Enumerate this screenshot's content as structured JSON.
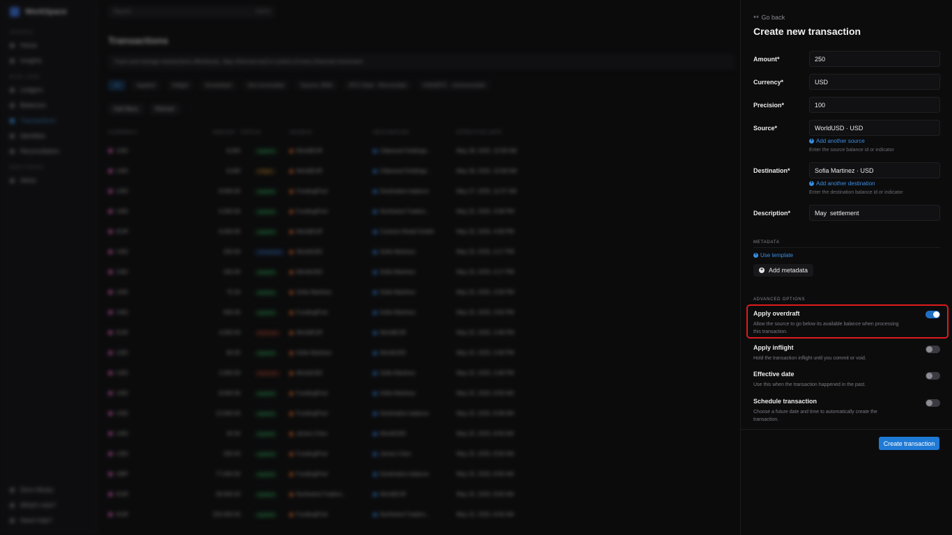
{
  "background": {
    "workspace": "WorkSpace",
    "search_placeholder": "Search",
    "search_shortcut": "Ctrl K",
    "sidebar_sections": [
      {
        "label": "GENERAL",
        "items": [
          "Home",
          "Insights"
        ]
      },
      {
        "label": "BLNK CORE",
        "items": [
          "Ledgers",
          "Balances",
          "Transactions",
          "Identities",
          "Reconciliation"
        ]
      },
      {
        "label": "MONITORING",
        "items": [
          "Alerts"
        ]
      }
    ],
    "active_item": "Transactions",
    "sidebar_bottom": [
      "Docs library",
      "What's new?",
      "Need help?"
    ],
    "page_title": "Transactions",
    "page_subtitle": "Track and manage transactions effortlessly. Stay informed and in control of every financial movement",
    "filters": [
      "All",
      "Applied",
      "Inflight",
      "Scheduled",
      "Not reconciled",
      "Source: BNK",
      "BTC Dest · Reconciled",
      "USD/BTC · Unreconciled"
    ],
    "actions": [
      "Add filters",
      "Refresh"
    ],
    "columns": [
      "CURRENCY",
      "AMOUNT",
      "STATUS",
      "SOURCE",
      "DESTINATION",
      "EFFECTIVE DATE"
    ],
    "rows": [
      {
        "currency": "USD",
        "amount": "8,000",
        "status": "Applied",
        "status_kind": "ok",
        "source": "WorldEUR",
        "destination": "Oakwood Holdings...",
        "date": "May 28, 2025, 10:58 AM"
      },
      {
        "currency": "USD",
        "amount": "8,000",
        "status": "Inflight",
        "status_kind": "warn",
        "source": "WorldEUR",
        "destination": "Oakwood Holdings...",
        "date": "May 28, 2025, 10:58 AM"
      },
      {
        "currency": "USD",
        "amount": "8,000.00",
        "status": "Applied",
        "status_kind": "ok",
        "source": "FundingPool",
        "destination": "Destination balance",
        "date": "May 27, 2025, 11:57 AM"
      },
      {
        "currency": "USD",
        "amount": "5,000.00",
        "status": "Applied",
        "status_kind": "ok",
        "source": "FundingPool",
        "destination": "Northwind Traders...",
        "date": "May 22, 2025, 4:58 PM"
      },
      {
        "currency": "EUR",
        "amount": "6,000.00",
        "status": "Applied",
        "status_kind": "ok",
        "source": "WorldEUR",
        "destination": "Contoso Retail GmbH",
        "date": "May 22, 2025, 4:58 PM"
      },
      {
        "currency": "USD",
        "amount": "250.00",
        "status": "Scheduled",
        "status_kind": "info",
        "source": "WorldUSD",
        "destination": "Sofia Martinez",
        "date": "May 22, 2025, 4:17 PM"
      },
      {
        "currency": "USD",
        "amount": "250.00",
        "status": "Applied",
        "status_kind": "ok",
        "source": "WorldUSD",
        "destination": "Sofia Martinez",
        "date": "May 22, 2025, 4:17 PM"
      },
      {
        "currency": "USD",
        "amount": "75.20",
        "status": "Applied",
        "status_kind": "ok",
        "source": "Sofia Martinez",
        "destination": "Sofia Martinez",
        "date": "May 22, 2025, 3:59 PM"
      },
      {
        "currency": "USD",
        "amount": "500.00",
        "status": "Applied",
        "status_kind": "ok",
        "source": "FundingPool",
        "destination": "Sofia Martinez",
        "date": "May 22, 2025, 3:50 PM"
      },
      {
        "currency": "EUR",
        "amount": "4,000.00",
        "status": "Rejected",
        "status_kind": "bad",
        "source": "WorldEUR",
        "destination": "WorldEUR",
        "date": "May 22, 2025, 3:48 PM"
      },
      {
        "currency": "USD",
        "amount": "80.00",
        "status": "Applied",
        "status_kind": "ok",
        "source": "Sofia Martinez",
        "destination": "WorldUSD",
        "date": "May 22, 2025, 3:48 PM"
      },
      {
        "currency": "USD",
        "amount": "2,000.00",
        "status": "Rejected",
        "status_kind": "bad",
        "source": "WorldUSD",
        "destination": "Sofia Martinez",
        "date": "May 22, 2025, 3:48 PM"
      },
      {
        "currency": "USD",
        "amount": "8,000.00",
        "status": "Applied",
        "status_kind": "ok",
        "source": "FundingPool",
        "destination": "Sofia Martinez",
        "date": "May 22, 2025, 8:56 AM"
      },
      {
        "currency": "USD",
        "amount": "12,000.00",
        "status": "Applied",
        "status_kind": "ok",
        "source": "FundingPool",
        "destination": "Destination balance",
        "date": "May 22, 2025, 8:38 AM"
      },
      {
        "currency": "USD",
        "amount": "40.00",
        "status": "Applied",
        "status_kind": "ok",
        "source": "James Chen",
        "destination": "WorldUSD",
        "date": "May 22, 2025, 8:56 AM"
      },
      {
        "currency": "USD",
        "amount": "200.00",
        "status": "Applied",
        "status_kind": "ok",
        "source": "FundingPool",
        "destination": "James Chen",
        "date": "May 22, 2025, 8:56 AM"
      },
      {
        "currency": "GBP",
        "amount": "77,000.00",
        "status": "Applied",
        "status_kind": "ok",
        "source": "FundingPool",
        "destination": "Destination balance",
        "date": "May 22, 2025, 8:56 AM"
      },
      {
        "currency": "EUR",
        "amount": "28,000.00",
        "status": "Applied",
        "status_kind": "ok",
        "source": "Northwind Traders...",
        "destination": "WorldEUR",
        "date": "May 22, 2025, 8:56 AM"
      },
      {
        "currency": "EUR",
        "amount": "220,000.00",
        "status": "Applied",
        "status_kind": "ok",
        "source": "FundingPool",
        "destination": "Northwind Traders...",
        "date": "May 22, 2025, 8:56 AM"
      }
    ]
  },
  "panel": {
    "go_back": "Go back",
    "title": "Create new transaction",
    "fields": {
      "amount": {
        "label": "Amount*",
        "value": "250"
      },
      "currency": {
        "label": "Currency*",
        "value": "USD"
      },
      "precision": {
        "label": "Precision*",
        "value": "100"
      },
      "source": {
        "label": "Source*",
        "value": "WorldUSD · USD",
        "add_link": "Add another source",
        "hint": "Enter the source balance id or indicator"
      },
      "destination": {
        "label": "Destination*",
        "value": "Sofia Martinez · USD",
        "add_link": "Add another destination",
        "hint": "Enter the destination balance id or indicator"
      },
      "description": {
        "label": "Description*",
        "value": "May  settlement"
      }
    },
    "metadata": {
      "heading": "METADATA",
      "use_template": "Use template",
      "add_metadata": "Add metadata"
    },
    "advanced": {
      "heading": "ADVANCED OPTIONS",
      "options": [
        {
          "title": "Apply overdraft",
          "desc": "Allow the source to go below its available balance when processing this transaction.",
          "on": true
        },
        {
          "title": "Apply inflight",
          "desc": "Hold the transaction inflight until you commit or void.",
          "on": false
        },
        {
          "title": "Effective date",
          "desc": "Use this when the transaction happened in the past.",
          "on": false
        },
        {
          "title": "Schedule transaction",
          "desc": "Choose a future date and time to automatically create the transaction.",
          "on": false
        }
      ]
    },
    "submit_label": "Create transaction",
    "colors": {
      "accent": "#1f7ad6",
      "highlight": "#e01a1a"
    }
  }
}
